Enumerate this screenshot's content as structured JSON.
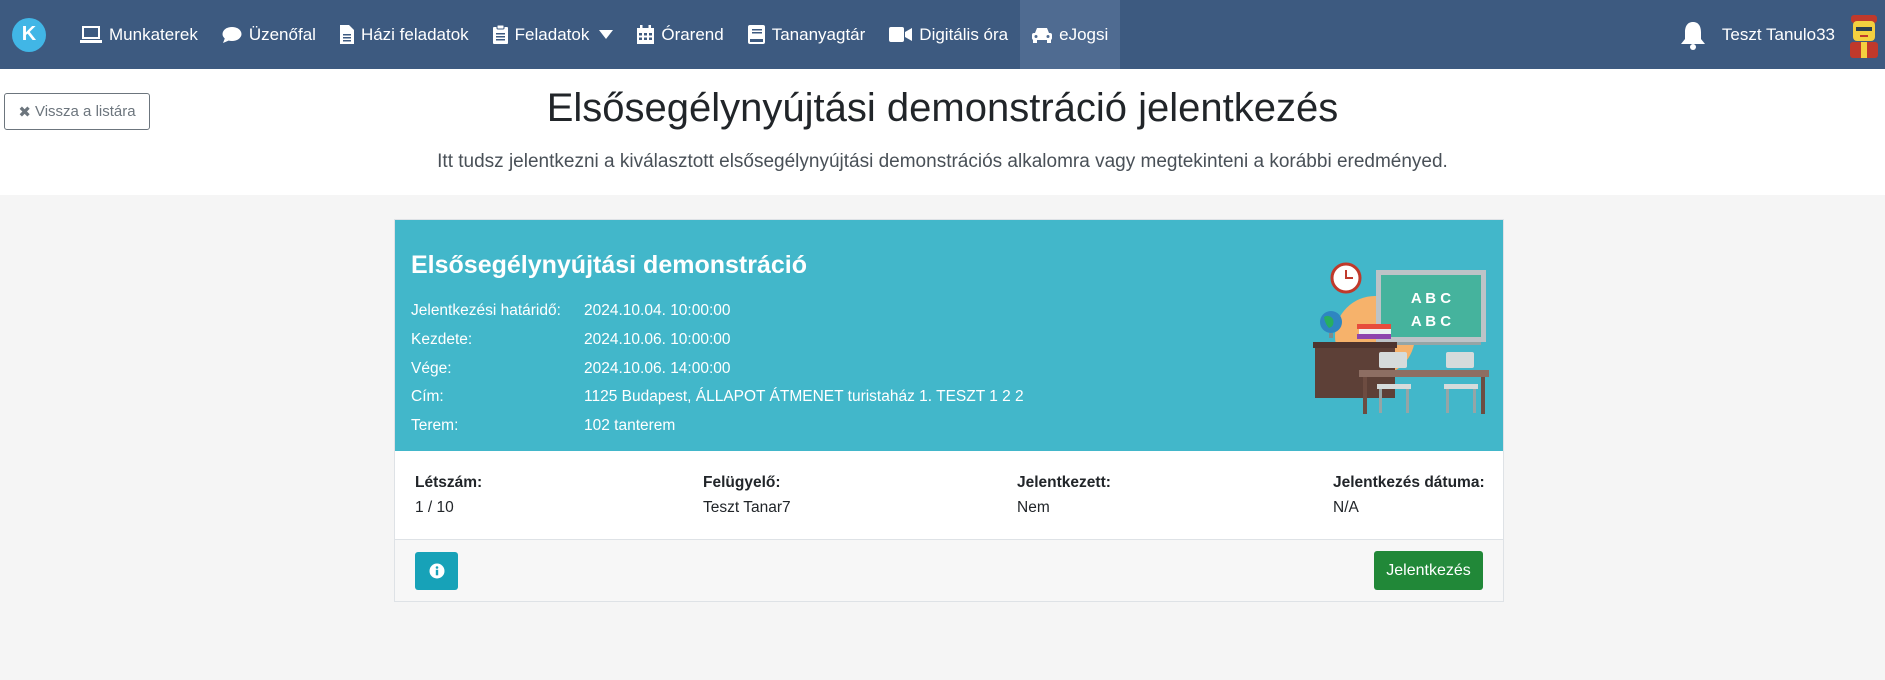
{
  "nav": {
    "brand_letter": "K",
    "items": [
      {
        "label": "Munkaterek",
        "icon": "laptop-icon"
      },
      {
        "label": "Üzenőfal",
        "icon": "comment-icon"
      },
      {
        "label": "Házi feladatok",
        "icon": "file-icon"
      },
      {
        "label": "Feladatok",
        "icon": "clipboard-icon"
      },
      {
        "label": "Órarend",
        "icon": "calendar-icon"
      },
      {
        "label": "Tananyagtár",
        "icon": "book-icon"
      },
      {
        "label": "Digitális óra",
        "icon": "video-icon"
      },
      {
        "label": "eJogsi",
        "icon": "car-icon"
      }
    ],
    "username": "Teszt Tanulo33"
  },
  "header": {
    "back_label": "Vissza a listára",
    "title": "Elsősegélynyújtási demonstráció jelentkezés",
    "subtitle": "Itt tudsz jelentkezni a kiválasztott elsősegélynyújtási demonstrációs alkalomra vagy megtekinteni a korábbi eredményed."
  },
  "card": {
    "title": "Elsősegélynyújtási demonstráció",
    "info": [
      {
        "label": "Jelentkezési határidő:",
        "value": "2024.10.04. 10:00:00"
      },
      {
        "label": "Kezdete:",
        "value": "2024.10.06. 10:00:00"
      },
      {
        "label": "Vége:",
        "value": "2024.10.06. 14:00:00"
      },
      {
        "label": "Cím:",
        "value": "1125 Budapest, ÁLLAPOT ÁTMENET turistaház 1. TESZT 1 2 2"
      },
      {
        "label": "Terem:",
        "value": "102 tanterem"
      }
    ],
    "board_text": [
      "A B C",
      "A B C"
    ],
    "stats": [
      {
        "label": "Létszám:",
        "value": "1 / 10"
      },
      {
        "label": "Felügyelő:",
        "value": "Teszt Tanar7"
      },
      {
        "label": "Jelentkezett:",
        "value": "Nem"
      },
      {
        "label": "Jelentkezés dátuma:",
        "value": "N/A"
      }
    ],
    "apply_label": "Jelentkezés"
  },
  "colors": {
    "navbar": "#3d5a80",
    "card_header": "#42b7ca",
    "apply_button": "#218838",
    "info_button": "#17a2b8"
  }
}
